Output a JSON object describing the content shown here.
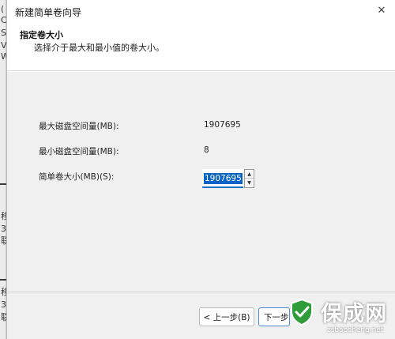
{
  "background_window": {
    "edge_chars": [
      "(",
      "C",
      "S",
      "V",
      "W",
      "移",
      "3",
      "联",
      "移",
      "3",
      "联"
    ]
  },
  "wizard": {
    "title": "新建简单卷向导",
    "close_glyph": "✕",
    "header": {
      "title": "指定卷大小",
      "subtitle": "选择介于最大和最小值的卷大小。"
    },
    "fields": {
      "max_label": "最大磁盘空间量(MB):",
      "max_value": "1907695",
      "min_label": "最小磁盘空间量(MB):",
      "min_value": "8",
      "size_label": "简单卷大小(MB)(S):",
      "size_value": "1907695"
    },
    "buttons": {
      "back": "< 上一步(B)",
      "next": "下一步"
    }
  },
  "watermark": {
    "name": "保成网",
    "url": "zsbaocheng.net",
    "color": "#2f9e3a"
  }
}
